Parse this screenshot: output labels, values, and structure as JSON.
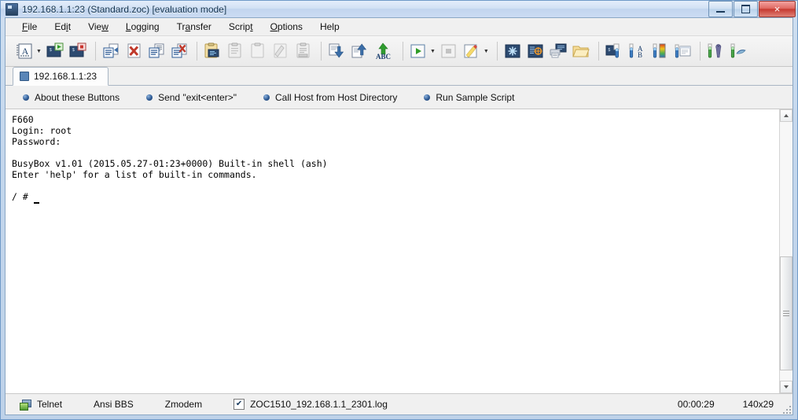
{
  "window": {
    "title": "192.168.1.1:23 (Standard.zoc) [evaluation mode]",
    "icon": "app-icon",
    "minimize_label": "Minimize",
    "maximize_label": "Maximize",
    "close_label": "×"
  },
  "menubar": {
    "items": [
      {
        "label": "File",
        "accel": "F",
        "pre": "",
        "post": "ile"
      },
      {
        "label": "Edit",
        "accel": "i",
        "pre": "Ed",
        "post": "t"
      },
      {
        "label": "View",
        "accel": "w",
        "pre": "Vie",
        "post": ""
      },
      {
        "label": "Logging",
        "accel": "L",
        "pre": "",
        "post": "ogging"
      },
      {
        "label": "Transfer",
        "accel": "a",
        "pre": "Tr",
        "post": "nsfer"
      },
      {
        "label": "Script",
        "accel": "t",
        "pre": "Scrip",
        "post": ""
      },
      {
        "label": "Options",
        "accel": "O",
        "pre": "",
        "post": "ptions"
      },
      {
        "label": "Help",
        "accel": "",
        "pre": "Help",
        "post": ""
      }
    ]
  },
  "toolbar": {
    "groups": [
      {
        "buttons": [
          {
            "name": "new-session-icon",
            "tooltip": "New Session",
            "dropdown": true
          },
          {
            "name": "start-session-icon",
            "tooltip": "Connect Session"
          },
          {
            "name": "stop-session-icon",
            "tooltip": "Disconnect Session"
          }
        ]
      },
      {
        "buttons": [
          {
            "name": "paste-to-host-icon",
            "tooltip": "Paste to Host"
          },
          {
            "name": "clear-screen-icon",
            "tooltip": "Clear Screen"
          },
          {
            "name": "print-screen-icon",
            "tooltip": "Print Screen"
          },
          {
            "name": "clear-scrollback-icon",
            "tooltip": "Clear Scrollback"
          }
        ]
      },
      {
        "buttons": [
          {
            "name": "clipboard-paste-icon",
            "tooltip": "Paste"
          },
          {
            "name": "clipboard-copy-icon",
            "tooltip": "Copy"
          },
          {
            "name": "clipboard-empty-icon",
            "tooltip": "Clipboard"
          },
          {
            "name": "clipboard-mark-icon",
            "tooltip": "Mark"
          },
          {
            "name": "clipboard-print-icon",
            "tooltip": "Clipboard Print"
          }
        ]
      },
      {
        "buttons": [
          {
            "name": "download-file-icon",
            "tooltip": "Receive File"
          },
          {
            "name": "upload-file-icon",
            "tooltip": "Send File"
          },
          {
            "name": "send-text-abc-icon",
            "tooltip": "Send Text File"
          }
        ]
      },
      {
        "buttons": [
          {
            "name": "run-script-icon",
            "tooltip": "Run Script",
            "dropdown": true
          },
          {
            "name": "stop-script-icon",
            "tooltip": "Stop Script"
          },
          {
            "name": "edit-script-icon",
            "tooltip": "Edit Script",
            "dropdown": true
          }
        ]
      },
      {
        "buttons": [
          {
            "name": "new-window-icon",
            "tooltip": "New Window"
          },
          {
            "name": "host-directory-icon",
            "tooltip": "Host Directory"
          },
          {
            "name": "session-log-icon",
            "tooltip": "Session Logging"
          },
          {
            "name": "open-folder-icon",
            "tooltip": "Open Folder"
          }
        ]
      },
      {
        "buttons": [
          {
            "name": "session-profile-icon",
            "tooltip": "Session Profile"
          },
          {
            "name": "font-settings-icon",
            "tooltip": "Font"
          },
          {
            "name": "color-settings-icon",
            "tooltip": "Colors"
          },
          {
            "name": "window-settings-icon",
            "tooltip": "Window Options"
          }
        ]
      },
      {
        "buttons": [
          {
            "name": "tools-options-icon",
            "tooltip": "Options"
          },
          {
            "name": "device-settings-icon",
            "tooltip": "Device Settings"
          }
        ]
      }
    ]
  },
  "tabs": {
    "items": [
      {
        "label": "192.168.1.1:23",
        "active": true,
        "icon": "terminal-tab-icon"
      }
    ]
  },
  "buttonbar": {
    "items": [
      {
        "label": "About these Buttons"
      },
      {
        "label": "Send \"exit<enter>\""
      },
      {
        "label": "Call Host from Host Directory"
      },
      {
        "label": "Run Sample Script"
      }
    ]
  },
  "terminal": {
    "lines": [
      "F660",
      "Login: root",
      "Password:",
      "",
      "BusyBox v1.01 (2015.05.27-01:23+0000) Built-in shell (ash)",
      "Enter 'help' for a list of built-in commands.",
      "",
      "/ # "
    ],
    "prompt": "/ # ",
    "cursor_visible": true
  },
  "scrollbar": {
    "up_arrow": "scroll-up-icon",
    "down_arrow": "scroll-down-icon",
    "thumb_position_pct": 52,
    "thumb_size_pct": 44
  },
  "statusbar": {
    "connection_type": "Telnet",
    "emulation": "Ansi BBS",
    "transfer_protocol": "Zmodem",
    "log_checked": true,
    "log_file": "ZOC1510_192.168.1.1_2301.log",
    "elapsed": "00:00:29",
    "dimensions": "140x29"
  },
  "colors": {
    "accent": "#2f5c96",
    "titlebar_text": "#11324f",
    "terminal_bg": "#ffffff",
    "terminal_fg": "#000000",
    "close_button": "#c63a31"
  }
}
